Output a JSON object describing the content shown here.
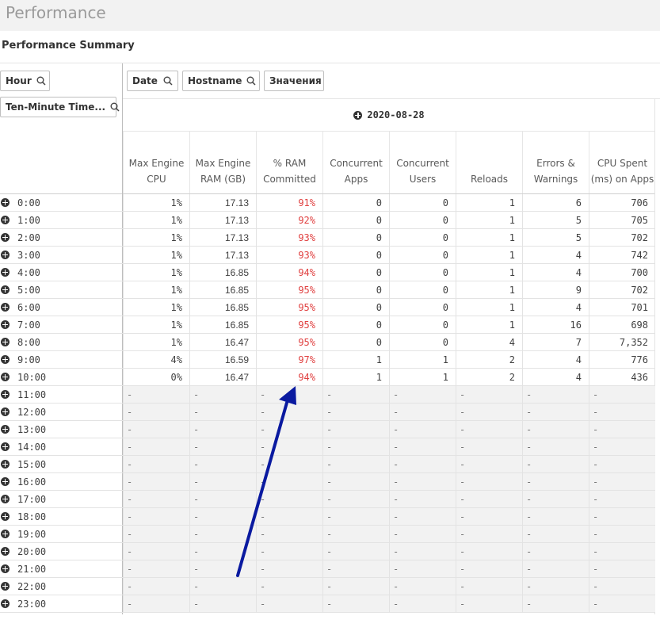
{
  "app": {
    "title": "Performance"
  },
  "summary": {
    "title": "Performance Summary"
  },
  "dimensions": {
    "left": [
      {
        "label": "Hour"
      },
      {
        "label": "Ten-Minute Time..."
      }
    ],
    "top": [
      {
        "label": "Date"
      },
      {
        "label": "Hostname"
      },
      {
        "label": "Значения"
      }
    ]
  },
  "date": "2020-08-28",
  "columns": [
    "Max Engine\nCPU",
    "Max Engine\nRAM (GB)",
    "% RAM\nCommitted",
    "Concurrent\nApps",
    "Concurrent\nUsers",
    "Reloads",
    "Errors &\nWarnings",
    "CPU Spent\n(ms) on Apps"
  ],
  "empty_symbol": "-",
  "colors": {
    "ram_committed": "#e04040",
    "arrow": "#0a1aa0"
  },
  "rows": [
    {
      "hour": "0:00",
      "values": [
        "1%",
        "17.13",
        "91%",
        "0",
        "0",
        "1",
        "6",
        "706"
      ]
    },
    {
      "hour": "1:00",
      "values": [
        "1%",
        "17.13",
        "92%",
        "0",
        "0",
        "1",
        "5",
        "705"
      ]
    },
    {
      "hour": "2:00",
      "values": [
        "1%",
        "17.13",
        "93%",
        "0",
        "0",
        "1",
        "5",
        "702"
      ]
    },
    {
      "hour": "3:00",
      "values": [
        "1%",
        "17.13",
        "93%",
        "0",
        "0",
        "1",
        "4",
        "742"
      ]
    },
    {
      "hour": "4:00",
      "values": [
        "1%",
        "16.85",
        "94%",
        "0",
        "0",
        "1",
        "4",
        "700"
      ]
    },
    {
      "hour": "5:00",
      "values": [
        "1%",
        "16.85",
        "95%",
        "0",
        "0",
        "1",
        "9",
        "702"
      ]
    },
    {
      "hour": "6:00",
      "values": [
        "1%",
        "16.85",
        "95%",
        "0",
        "0",
        "1",
        "4",
        "701"
      ]
    },
    {
      "hour": "7:00",
      "values": [
        "1%",
        "16.85",
        "95%",
        "0",
        "0",
        "1",
        "16",
        "698"
      ]
    },
    {
      "hour": "8:00",
      "values": [
        "1%",
        "16.47",
        "95%",
        "0",
        "0",
        "4",
        "7",
        "7,352"
      ]
    },
    {
      "hour": "9:00",
      "values": [
        "4%",
        "16.59",
        "97%",
        "1",
        "1",
        "2",
        "4",
        "776"
      ]
    },
    {
      "hour": "10:00",
      "values": [
        "0%",
        "16.47",
        "94%",
        "1",
        "1",
        "2",
        "4",
        "436"
      ]
    },
    {
      "hour": "11:00",
      "values": null
    },
    {
      "hour": "12:00",
      "values": null
    },
    {
      "hour": "13:00",
      "values": null
    },
    {
      "hour": "14:00",
      "values": null
    },
    {
      "hour": "15:00",
      "values": null
    },
    {
      "hour": "16:00",
      "values": null
    },
    {
      "hour": "17:00",
      "values": null
    },
    {
      "hour": "18:00",
      "values": null
    },
    {
      "hour": "19:00",
      "values": null
    },
    {
      "hour": "20:00",
      "values": null
    },
    {
      "hour": "21:00",
      "values": null
    },
    {
      "hour": "22:00",
      "values": null
    },
    {
      "hour": "23:00",
      "values": null
    }
  ]
}
